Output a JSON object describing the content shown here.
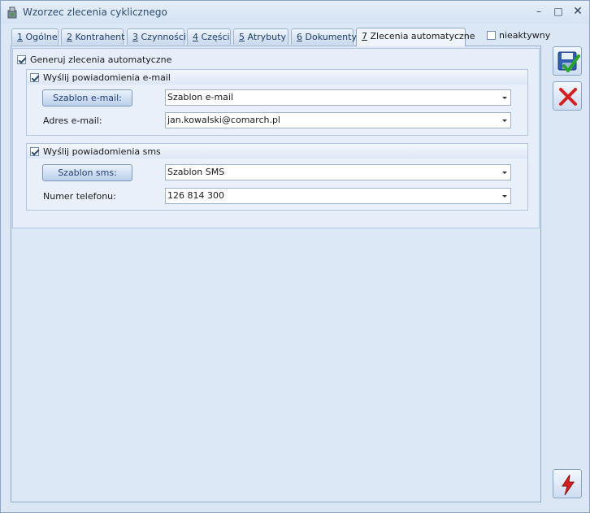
{
  "window": {
    "title": "Wzorzec zlecenia cyklicznego",
    "minimize_glyph": "–",
    "maximize_glyph": "□",
    "close_glyph": "✕"
  },
  "tabs": [
    {
      "num": "1",
      "label": " Ogólne"
    },
    {
      "num": "2",
      "label": " Kontrahent"
    },
    {
      "num": "3",
      "label": " Czynności"
    },
    {
      "num": "4",
      "label": " Części"
    },
    {
      "num": "5",
      "label": " Atrybuty"
    },
    {
      "num": "6",
      "label": " Dokumenty"
    },
    {
      "num": "7",
      "label": " Zlecenia automatyczne"
    }
  ],
  "active_tab": 6,
  "inactive_checkbox": {
    "label": "nieaktywny",
    "checked": false
  },
  "auto_orders": {
    "generate_label": "Generuj zlecenia automatyczne",
    "generate_checked": true,
    "email": {
      "send_label": "Wyślij powiadomienia e-mail",
      "send_checked": true,
      "template_button_label": "Szablon e-mail:",
      "template_value": "Szablon e-mail",
      "address_label": "Adres e-mail:",
      "address_value": "jan.kowalski@comarch.pl"
    },
    "sms": {
      "send_label": "Wyślij powiadomienia sms",
      "send_checked": true,
      "template_button_label": "Szablon sms:",
      "template_value": "Szablon SMS",
      "phone_label": "Numer telefonu:",
      "phone_value": "126 814 300"
    }
  },
  "toolbar": {
    "save_icon": "save-icon",
    "cancel_icon": "cancel-icon",
    "action_icon": "lightning-icon"
  },
  "colors": {
    "background": "#dbe7f5",
    "cancel_red": "#d42020",
    "save_green": "#2aa52a"
  }
}
